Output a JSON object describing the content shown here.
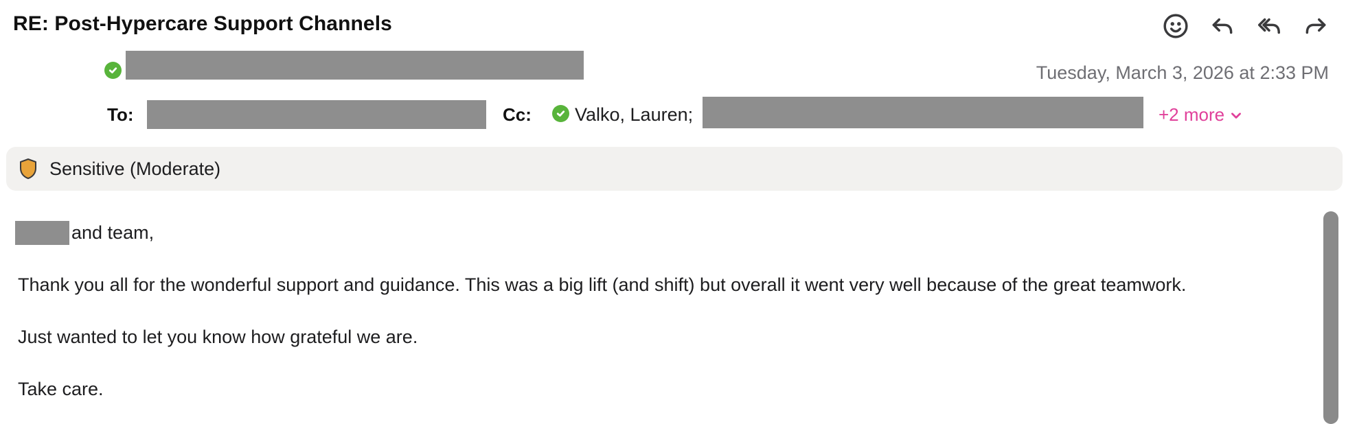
{
  "email": {
    "subject": "RE: Post-Hypercare Support Channels",
    "date": "Tuesday, March 3, 2026 at 2:33 PM",
    "to_label": "To:",
    "cc_label": "Cc:",
    "cc_visible_name": "Valko, Lauren;",
    "more_label": "+2 more"
  },
  "sensitivity": {
    "label": "Sensitive (Moderate)",
    "color": "#e8a33a"
  },
  "body": {
    "greeting_suffix": "and team,",
    "para1": "Thank you all for the wonderful support and guidance. This was a big lift (and shift) but overall it went very well because of the great teamwork.",
    "para2": "Just wanted to let you know how grateful we are.",
    "para3": "Take care."
  },
  "toolbar": {
    "icons": [
      "emoji-icon",
      "reply-icon",
      "reply-all-icon",
      "forward-icon"
    ]
  },
  "colors": {
    "verified": "#58b43b",
    "accent_pink": "#e0409a",
    "redaction": "#8e8e8e"
  }
}
